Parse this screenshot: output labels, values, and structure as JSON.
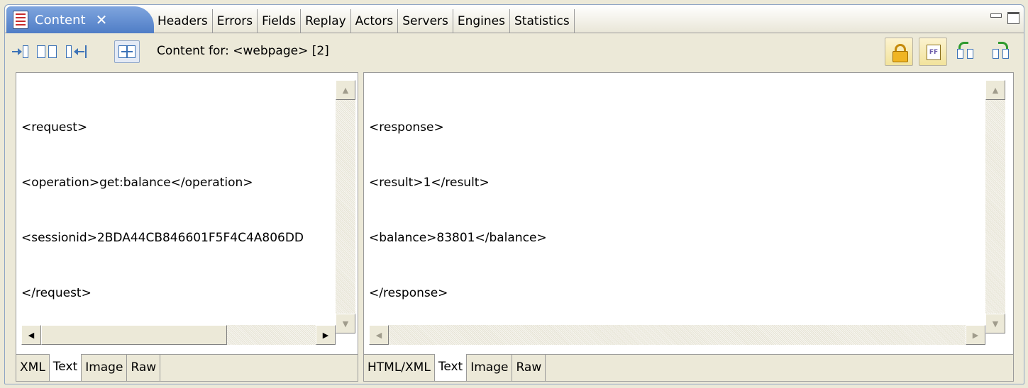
{
  "tabbar": {
    "active_tab": "Content",
    "close_glyph": "✕",
    "tabs": [
      "Headers",
      "Errors",
      "Fields",
      "Replay",
      "Actors",
      "Servers",
      "Engines",
      "Statistics"
    ]
  },
  "toolbar": {
    "content_for_label": "Content for: <webpage> [2]",
    "left_buttons": [
      "show-request-only-icon",
      "show-both-panes-icon",
      "show-response-only-icon",
      "side-by-side-icon"
    ],
    "right_buttons": [
      "lock-icon",
      "ff-icon",
      "previous-icon",
      "next-icon"
    ],
    "ff_text": "FF"
  },
  "request_pane": {
    "lines": [
      "<request>",
      "<operation>get:balance</operation>",
      "<sessionid>2BDA44CB846601F5F4C4A806DD",
      "</request>"
    ],
    "tabs": [
      "XML",
      "Text",
      "Image",
      "Raw"
    ],
    "active_tab": "Text"
  },
  "response_pane": {
    "lines": [
      "<response>",
      "<result>1</result>",
      "<balance>83801</balance>",
      "</response>"
    ],
    "tabs": [
      "HTML/XML",
      "Text",
      "Image",
      "Raw"
    ],
    "active_tab": "Text"
  },
  "scroll": {
    "up": "▲",
    "down": "▼",
    "left": "◀",
    "right": "▶"
  }
}
